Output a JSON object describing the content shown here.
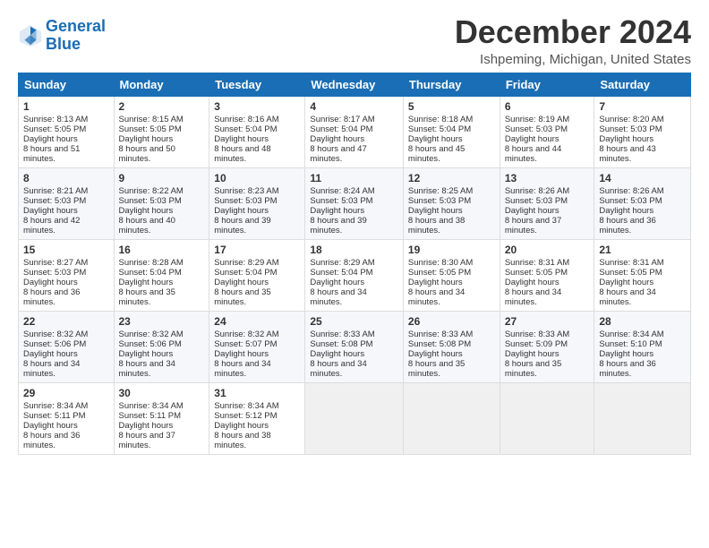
{
  "header": {
    "logo_line1": "General",
    "logo_line2": "Blue",
    "month": "December 2024",
    "location": "Ishpeming, Michigan, United States"
  },
  "weekdays": [
    "Sunday",
    "Monday",
    "Tuesday",
    "Wednesday",
    "Thursday",
    "Friday",
    "Saturday"
  ],
  "weeks": [
    [
      {
        "day": "1",
        "rise": "8:13 AM",
        "set": "5:05 PM",
        "daylight": "8 hours and 51 minutes."
      },
      {
        "day": "2",
        "rise": "8:15 AM",
        "set": "5:05 PM",
        "daylight": "8 hours and 50 minutes."
      },
      {
        "day": "3",
        "rise": "8:16 AM",
        "set": "5:04 PM",
        "daylight": "8 hours and 48 minutes."
      },
      {
        "day": "4",
        "rise": "8:17 AM",
        "set": "5:04 PM",
        "daylight": "8 hours and 47 minutes."
      },
      {
        "day": "5",
        "rise": "8:18 AM",
        "set": "5:04 PM",
        "daylight": "8 hours and 45 minutes."
      },
      {
        "day": "6",
        "rise": "8:19 AM",
        "set": "5:03 PM",
        "daylight": "8 hours and 44 minutes."
      },
      {
        "day": "7",
        "rise": "8:20 AM",
        "set": "5:03 PM",
        "daylight": "8 hours and 43 minutes."
      }
    ],
    [
      {
        "day": "8",
        "rise": "8:21 AM",
        "set": "5:03 PM",
        "daylight": "8 hours and 42 minutes."
      },
      {
        "day": "9",
        "rise": "8:22 AM",
        "set": "5:03 PM",
        "daylight": "8 hours and 40 minutes."
      },
      {
        "day": "10",
        "rise": "8:23 AM",
        "set": "5:03 PM",
        "daylight": "8 hours and 39 minutes."
      },
      {
        "day": "11",
        "rise": "8:24 AM",
        "set": "5:03 PM",
        "daylight": "8 hours and 39 minutes."
      },
      {
        "day": "12",
        "rise": "8:25 AM",
        "set": "5:03 PM",
        "daylight": "8 hours and 38 minutes."
      },
      {
        "day": "13",
        "rise": "8:26 AM",
        "set": "5:03 PM",
        "daylight": "8 hours and 37 minutes."
      },
      {
        "day": "14",
        "rise": "8:26 AM",
        "set": "5:03 PM",
        "daylight": "8 hours and 36 minutes."
      }
    ],
    [
      {
        "day": "15",
        "rise": "8:27 AM",
        "set": "5:03 PM",
        "daylight": "8 hours and 36 minutes."
      },
      {
        "day": "16",
        "rise": "8:28 AM",
        "set": "5:04 PM",
        "daylight": "8 hours and 35 minutes."
      },
      {
        "day": "17",
        "rise": "8:29 AM",
        "set": "5:04 PM",
        "daylight": "8 hours and 35 minutes."
      },
      {
        "day": "18",
        "rise": "8:29 AM",
        "set": "5:04 PM",
        "daylight": "8 hours and 34 minutes."
      },
      {
        "day": "19",
        "rise": "8:30 AM",
        "set": "5:05 PM",
        "daylight": "8 hours and 34 minutes."
      },
      {
        "day": "20",
        "rise": "8:31 AM",
        "set": "5:05 PM",
        "daylight": "8 hours and 34 minutes."
      },
      {
        "day": "21",
        "rise": "8:31 AM",
        "set": "5:05 PM",
        "daylight": "8 hours and 34 minutes."
      }
    ],
    [
      {
        "day": "22",
        "rise": "8:32 AM",
        "set": "5:06 PM",
        "daylight": "8 hours and 34 minutes."
      },
      {
        "day": "23",
        "rise": "8:32 AM",
        "set": "5:06 PM",
        "daylight": "8 hours and 34 minutes."
      },
      {
        "day": "24",
        "rise": "8:32 AM",
        "set": "5:07 PM",
        "daylight": "8 hours and 34 minutes."
      },
      {
        "day": "25",
        "rise": "8:33 AM",
        "set": "5:08 PM",
        "daylight": "8 hours and 34 minutes."
      },
      {
        "day": "26",
        "rise": "8:33 AM",
        "set": "5:08 PM",
        "daylight": "8 hours and 35 minutes."
      },
      {
        "day": "27",
        "rise": "8:33 AM",
        "set": "5:09 PM",
        "daylight": "8 hours and 35 minutes."
      },
      {
        "day": "28",
        "rise": "8:34 AM",
        "set": "5:10 PM",
        "daylight": "8 hours and 36 minutes."
      }
    ],
    [
      {
        "day": "29",
        "rise": "8:34 AM",
        "set": "5:11 PM",
        "daylight": "8 hours and 36 minutes."
      },
      {
        "day": "30",
        "rise": "8:34 AM",
        "set": "5:11 PM",
        "daylight": "8 hours and 37 minutes."
      },
      {
        "day": "31",
        "rise": "8:34 AM",
        "set": "5:12 PM",
        "daylight": "8 hours and 38 minutes."
      },
      null,
      null,
      null,
      null
    ]
  ]
}
